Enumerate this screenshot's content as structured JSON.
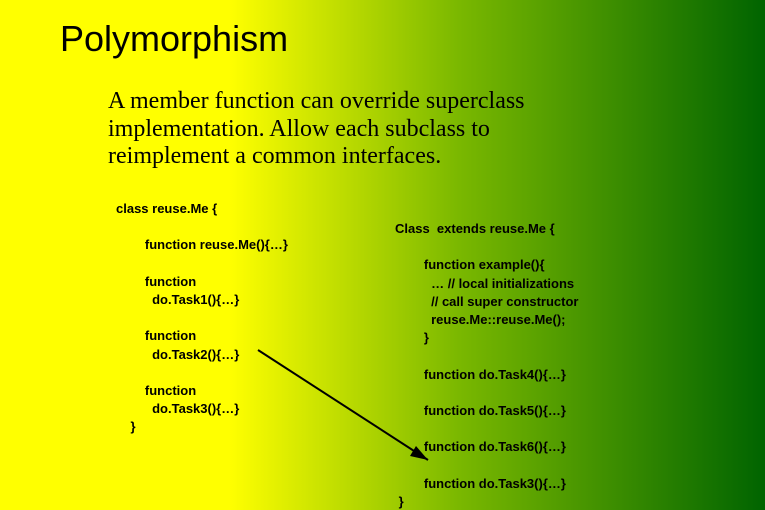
{
  "title": "Polymorphism",
  "body": "A member function can override superclass implementation. Allow each subclass to reimplement a  common interfaces.",
  "code_left": "class reuse.Me {\n\n        function reuse.Me(){…}\n\n        function\n          do.Task1(){…}\n\n        function\n          do.Task2(){…}\n\n        function\n          do.Task3(){…}\n    }",
  "code_right": "Class  extends reuse.Me {\n\n        function example(){\n          … // local initializations\n          // call super constructor\n          reuse.Me::reuse.Me();\n        }\n\n        function do.Task4(){…}\n\n        function do.Task5(){…}\n\n        function do.Task6(){…}\n\n        function do.Task3(){…}\n }"
}
